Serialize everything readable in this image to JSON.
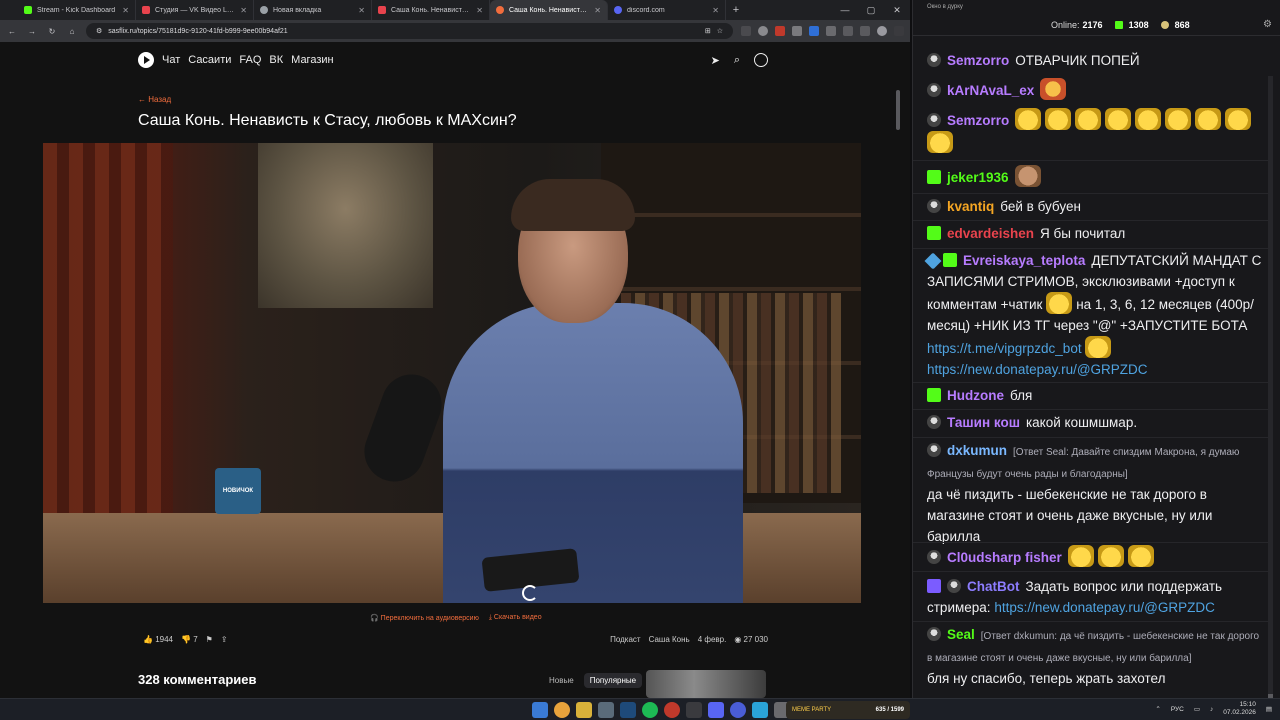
{
  "browser": {
    "tabs": [
      {
        "title": "Stream - Kick Dashboard",
        "color": "#53fc18"
      },
      {
        "title": "Студия — VK Видео Live",
        "color": "#e8434d"
      },
      {
        "title": "Новая вкладка",
        "color": "#9aa0a6"
      },
      {
        "title": "Саша Конь. Ненависть к Стасу",
        "color": "#e8434d"
      },
      {
        "title": "Саша Конь. Ненависть к С",
        "color": "#f26d3d",
        "active": true
      },
      {
        "title": "discord.com",
        "color": "#5865f2"
      }
    ],
    "url": "sasflix.ru/topics/75181d9c-9120-41fd-b999-9ee00b94af21"
  },
  "site": {
    "nav": [
      "Чат",
      "Сасаити",
      "FAQ",
      "ВК",
      "Магазин"
    ],
    "back_label": "← Назад",
    "title": "Саша Конь. Ненависть к Стасу, любовь к МАХсин?",
    "video_mug_text": "НОВИЧОК",
    "audio_link": "Переключить на аудиоверсию",
    "download_link": "Скачать видео",
    "likes": "1944",
    "dislikes": "7",
    "tag1": "Подкаст",
    "tag2": "Саша Конь",
    "date": "4 февр.",
    "views": "27 030",
    "comments_count": "328 комментариев",
    "sort_new": "Новые",
    "sort_popular": "Популярные"
  },
  "chat": {
    "window_title": "Окно в дурку",
    "online_label": "Online:",
    "online_count": "2176",
    "stat1": "1308",
    "stat2": "868",
    "messages": [
      {
        "user": "Semzorro",
        "color": "#b77cff",
        "text": "ОТВАРЧИК ПОПЕЙ"
      },
      {
        "user": "kArNAvaL_ex",
        "color": "#b77cff",
        "text": ""
      },
      {
        "user": "Semzorro",
        "color": "#b77cff",
        "text": ""
      },
      {
        "user": "jeker1936",
        "color": "#53fc18",
        "text": ""
      },
      {
        "user": "kvantiq",
        "color": "#f5a623",
        "text": "бей в бубуен"
      },
      {
        "user": "edvardeishen",
        "color": "#e8434d",
        "text": "Я бы почитал"
      },
      {
        "user": "Evreiskaya_teplota",
        "color": "#b77cff",
        "text": "ДЕПУТАТСКИЙ МАНДАТ С ЗАПИСЯМИ СТРИМОВ, эксклюзивами +доступ к комментам +чатик",
        "text2": "на 1, 3, 6, 12 месяцев (400р/месяц) +НИК ИЗ ТГ через \"@\" +ЗАПУСТИТЕ БОТА",
        "link1": "https://t.me/vipgrpzdc_bot",
        "link2": "https://new.donatepay.ru/@GRPZDC"
      },
      {
        "user": "Hudzone",
        "color": "#b77cff",
        "text": "бля"
      },
      {
        "user": "Ташин кош",
        "color": "#b77cff",
        "text": "какой кошмшмар."
      },
      {
        "user": "dxkumun",
        "color": "#7ab8ff",
        "reply": "[Ответ Seal: Давайте спиздим Макрона, я думаю Французы будут очень рады и благодарны]",
        "text": "да чё пиздить - шебекенские не так дорого в магазине стоят и очень даже вкусные, ну или барилла"
      },
      {
        "user": "Cl0udsharp fisher",
        "color": "#b77cff",
        "text": ""
      },
      {
        "user": "ChatBot",
        "color": "#8d7dff",
        "text": "Задать вопрос или поддержать стримера:",
        "link1": "https://new.donatepay.ru/@GRPZDC"
      },
      {
        "user": "Seal",
        "color": "#53fc18",
        "reply": "[Ответ dxkumun: да чё пиздить - шебекенские не так дорого в магазине стоят и очень даже вкусные, ну или барилла]",
        "text": "бля ну спасибо, теперь жрать захотел"
      }
    ]
  },
  "taskbar": {
    "meme_label": "MEME PARTY",
    "meme_count": "635 / 1599",
    "lang": "РУС",
    "time": "15:10",
    "date": "07.02.2026"
  }
}
